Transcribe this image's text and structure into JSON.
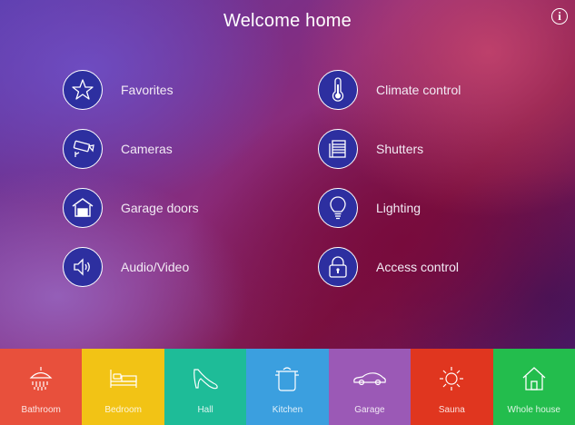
{
  "header": {
    "title": "Welcome home",
    "info_icon": "info-icon"
  },
  "menu": {
    "left": [
      {
        "label": "Favorites",
        "icon": "star-icon"
      },
      {
        "label": "Cameras",
        "icon": "camera-icon"
      },
      {
        "label": "Garage doors",
        "icon": "garage-icon"
      },
      {
        "label": "Audio/Video",
        "icon": "speaker-icon"
      }
    ],
    "right": [
      {
        "label": "Climate control",
        "icon": "thermometer-icon"
      },
      {
        "label": "Shutters",
        "icon": "shutters-icon"
      },
      {
        "label": "Lighting",
        "icon": "lightbulb-icon"
      },
      {
        "label": "Access control",
        "icon": "lock-icon"
      }
    ]
  },
  "tabs": [
    {
      "label": "Bathroom",
      "icon": "shower-icon",
      "color": "#e8503c"
    },
    {
      "label": "Bedroom",
      "icon": "bed-icon",
      "color": "#f2c315"
    },
    {
      "label": "Hall",
      "icon": "high-heel-icon",
      "color": "#1ebc98"
    },
    {
      "label": "Kitchen",
      "icon": "pot-icon",
      "color": "#3b9fdf"
    },
    {
      "label": "Garage",
      "icon": "car-icon",
      "color": "#9b59b6"
    },
    {
      "label": "Sauna",
      "icon": "sun-icon",
      "color": "#e0361f"
    },
    {
      "label": "Whole house",
      "icon": "house-icon",
      "color": "#23bd4d"
    }
  ]
}
